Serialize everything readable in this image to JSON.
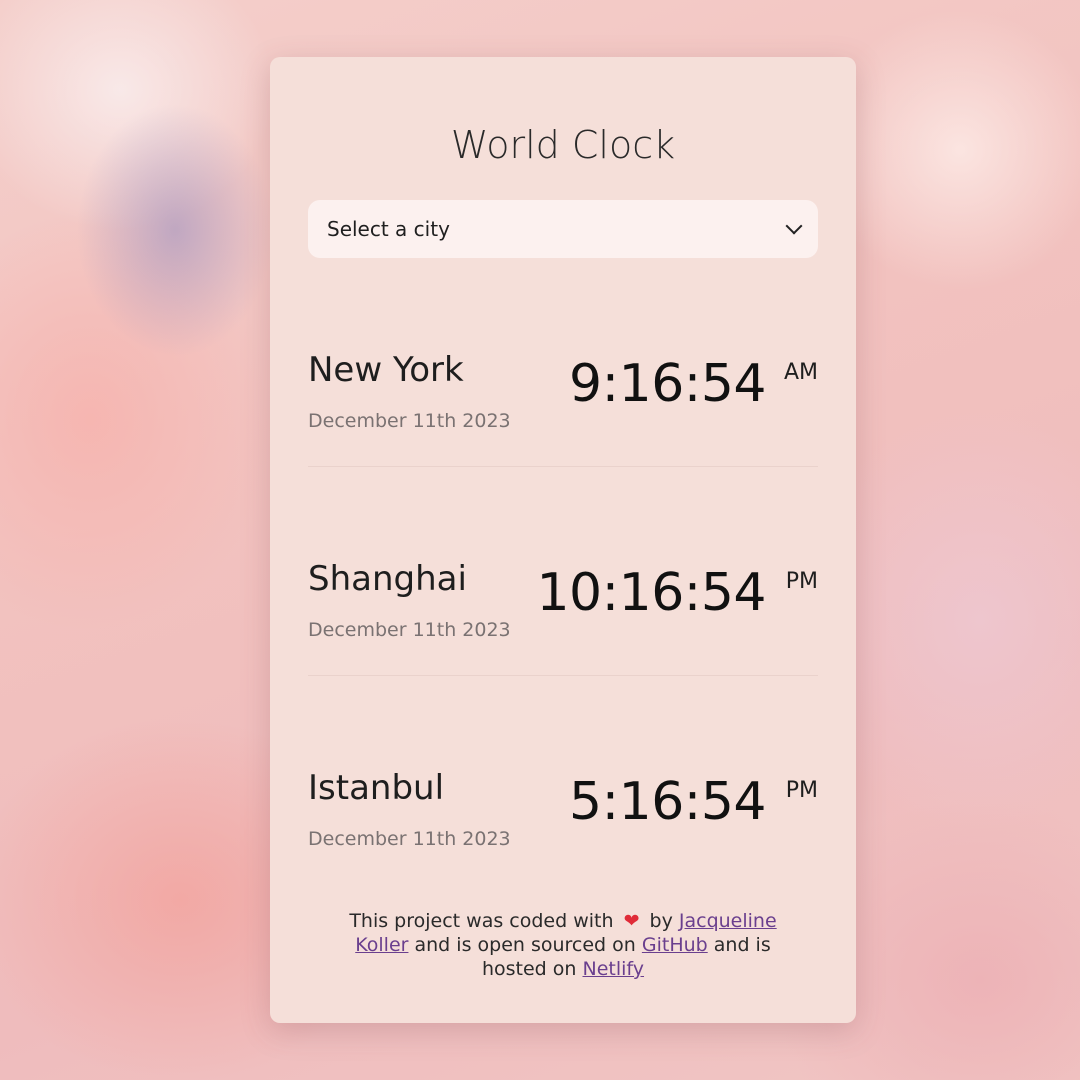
{
  "app": {
    "title": "World Clock"
  },
  "select": {
    "value": "Select a city"
  },
  "cities": [
    {
      "name": "New York",
      "date": "December 11th 2023",
      "time": "9:16:54",
      "ampm": "AM"
    },
    {
      "name": "Shanghai",
      "date": "December 11th 2023",
      "time": "10:16:54",
      "ampm": "PM"
    },
    {
      "name": "Istanbul",
      "date": "December 11th 2023",
      "time": "5:16:54",
      "ampm": "PM"
    }
  ],
  "footer": {
    "text_1": "This project was coded with",
    "heart_icon": "heart-icon",
    "text_2": "by",
    "author_link": "Jacqueline Koller",
    "text_3": "and is open sourced on",
    "github_link": "GitHub",
    "text_4": "and is hosted on",
    "netlify_link": "Netlify"
  },
  "colors": {
    "card_background": "#f5dfd9",
    "select_background": "#fcf1ef",
    "link": "#6a3f8e",
    "heart": "#e02b38"
  }
}
